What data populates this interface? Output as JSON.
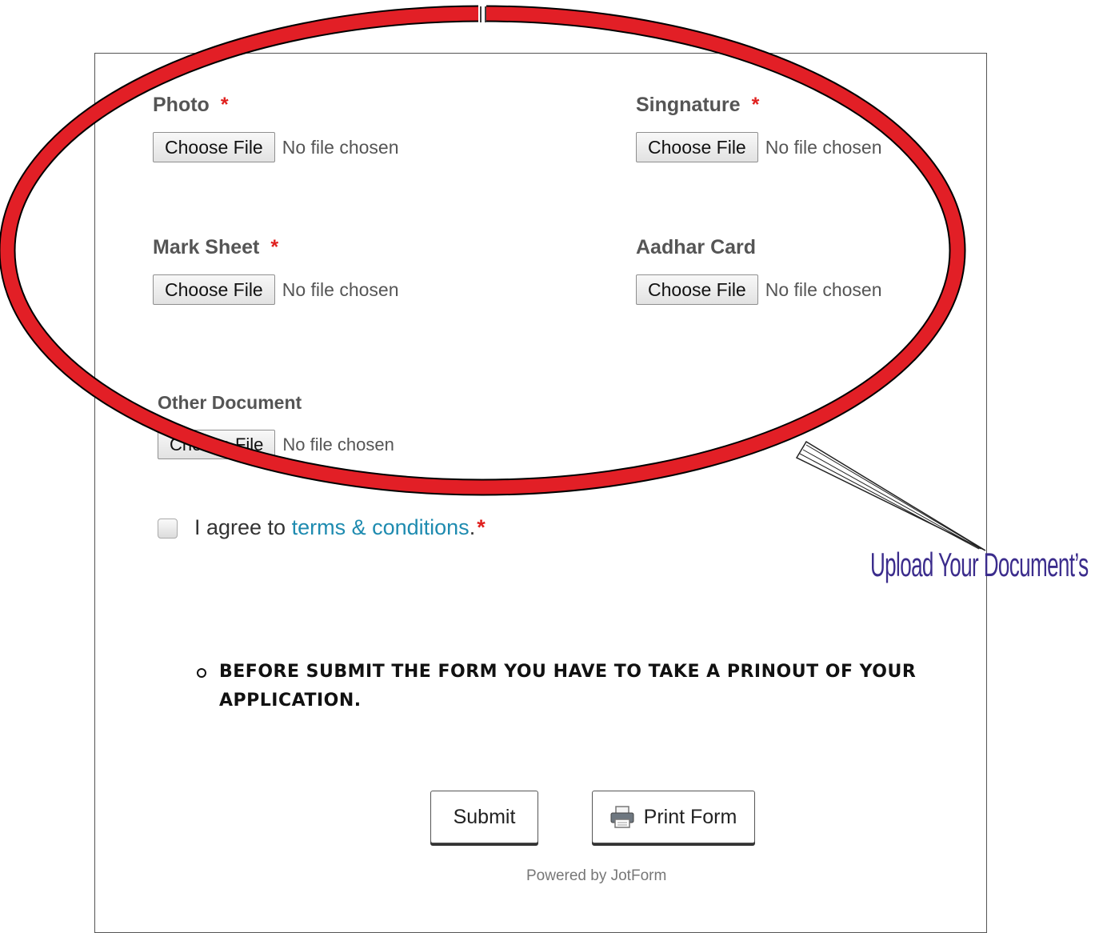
{
  "form": {
    "fields": [
      {
        "label": "Photo",
        "required": "*",
        "button": "Choose File",
        "status": "No file chosen"
      },
      {
        "label": "Singnature",
        "required": "*",
        "button": "Choose File",
        "status": "No file chosen"
      },
      {
        "label": "Mark Sheet",
        "required": "*",
        "button": "Choose File",
        "status": "No file chosen"
      },
      {
        "label": "Aadhar Card",
        "required": "",
        "button": "Choose File",
        "status": "No file chosen"
      },
      {
        "label": "Other Document",
        "required": "",
        "button": "Choose File",
        "status": "No file chosen"
      }
    ],
    "agree": {
      "prefix": "I agree to ",
      "link": "terms & conditions",
      "suffix": ".",
      "required": "*"
    },
    "notice": "BEFORE SUBMIT THE FORM YOU HAVE TO TAKE A PRINOUT OF YOUR APPLICATION.",
    "buttons": {
      "submit": "Submit",
      "print": "Print Form"
    },
    "powered_by": "Powered by JotForm"
  },
  "annotation": {
    "callout": "Upload Your Document’s",
    "colors": {
      "ellipse": "#e21f26",
      "text": "#3b2c8c"
    }
  },
  "icons": {
    "print": "printer-icon"
  }
}
